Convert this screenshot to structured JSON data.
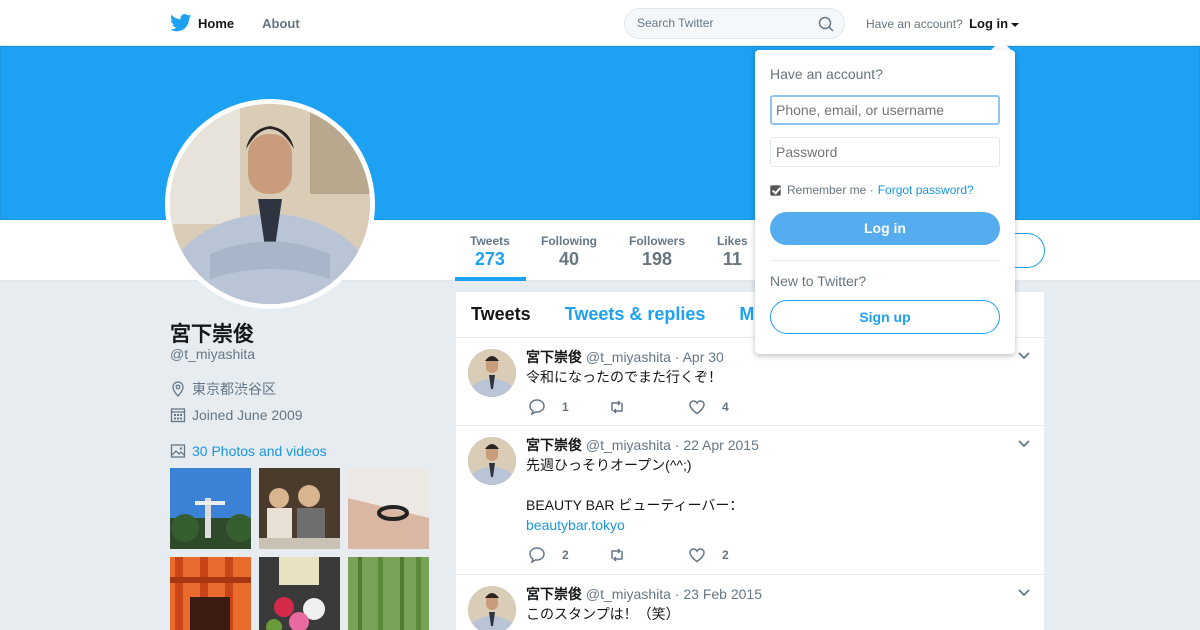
{
  "nav": {
    "home": "Home",
    "about": "About",
    "search_placeholder": "Search Twitter",
    "have_account": "Have an account?",
    "login": "Log in"
  },
  "profile": {
    "name": "宮下崇俊",
    "handle": "@t_miyashita",
    "location": "東京都渋谷区",
    "joined": "Joined June 2009",
    "photos_label": "30 Photos and videos"
  },
  "stats": [
    {
      "label": "Tweets",
      "value": "273"
    },
    {
      "label": "Following",
      "value": "40"
    },
    {
      "label": "Followers",
      "value": "198"
    },
    {
      "label": "Likes",
      "value": "11"
    }
  ],
  "timeline": {
    "tabs": [
      "Tweets",
      "Tweets & replies",
      "M"
    ]
  },
  "tweets": [
    {
      "name": "宮下崇俊",
      "handle": "@t_miyashita",
      "date": "· Apr 30",
      "text": "令和になったのでまた行くぞ！",
      "replies": "1",
      "retweets": "",
      "likes": "4"
    },
    {
      "name": "宮下崇俊",
      "handle": "@t_miyashita",
      "date": "· 22 Apr 2015",
      "text1": "先週ひっそりオープン(^^;)",
      "text2": "BEAUTY BAR ビューティーバー：",
      "link": "beautybar.tokyo",
      "replies": "2",
      "retweets": "",
      "likes": "2"
    },
    {
      "name": "宮下崇俊",
      "handle": "@t_miyashita",
      "date": "· 23 Feb 2015",
      "text": "このスタンプは！（笑）"
    }
  ],
  "login_dropdown": {
    "title": "Have an account?",
    "username_placeholder": "Phone, email, or username",
    "password_placeholder": "Password",
    "remember_me": "Remember me ·",
    "forgot_password": "Forgot password?",
    "login_button": "Log in",
    "new_to_twitter": "New to Twitter?",
    "signup_button": "Sign up"
  },
  "colors": {
    "brand_blue": "#1da1f2",
    "link_blue": "#1b95e0",
    "muted": "#657786"
  }
}
